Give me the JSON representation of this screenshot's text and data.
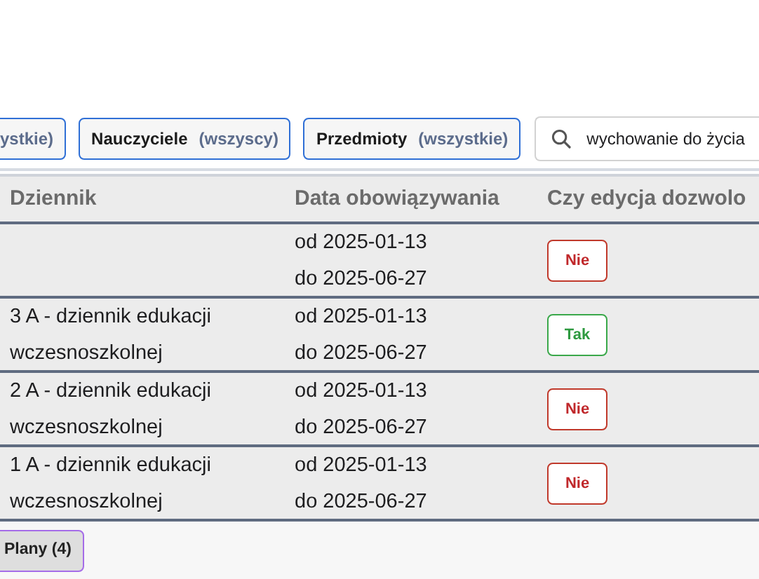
{
  "filters": [
    {
      "value": "ystkie)"
    },
    {
      "label": "Nauczyciele",
      "value": "(wszyscy)"
    },
    {
      "label": "Przedmioty",
      "value": "(wszystkie)"
    }
  ],
  "search": {
    "value": "wychowanie do życia"
  },
  "table": {
    "columns": [
      "Dziennik",
      "Data obowiązywania",
      "Czy edycja dozwolo"
    ],
    "rows": [
      {
        "journal": "",
        "from": "od 2025-01-13",
        "to": "do 2025-06-27",
        "edit": {
          "label": "Nie",
          "allowed": false
        }
      },
      {
        "journal": "3 A - dziennik edukacji wczesnoszkolnej",
        "from": "od 2025-01-13",
        "to": "do 2025-06-27",
        "edit": {
          "label": "Tak",
          "allowed": true
        }
      },
      {
        "journal": "2 A - dziennik edukacji wczesnoszkolnej",
        "from": "od 2025-01-13",
        "to": "do 2025-06-27",
        "edit": {
          "label": "Nie",
          "allowed": false
        }
      },
      {
        "journal": "1 A - dziennik edukacji wczesnoszkolnej",
        "from": "od 2025-01-13",
        "to": "do 2025-06-27",
        "edit": {
          "label": "Nie",
          "allowed": false
        }
      }
    ]
  },
  "footer_button": "Plany (4)"
}
